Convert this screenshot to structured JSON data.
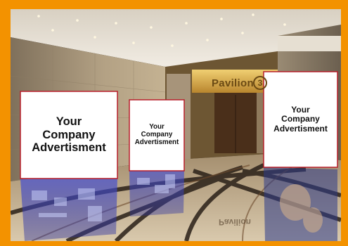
{
  "venue": {
    "sign_text": "Pavilion",
    "sign_number": "3",
    "reflected_sign_text": "Pavilion"
  },
  "billboards": [
    {
      "text": "Your\nCompany\nAdvertisment"
    },
    {
      "text": "Your\nCompany\nAdvertisment"
    },
    {
      "text": "Your\nCompany\nAdvertisment"
    }
  ],
  "colors": {
    "frame": "#f39200",
    "billboard_fill": "#ffffff",
    "billboard_edge": "#b81e2a",
    "wall_stone": "#b7a586",
    "marble_floor": "#c9b79b",
    "ceiling": "#e9e2d6",
    "lobby_glow": "#e0b347",
    "reflection_blue": "#3a43c7"
  }
}
